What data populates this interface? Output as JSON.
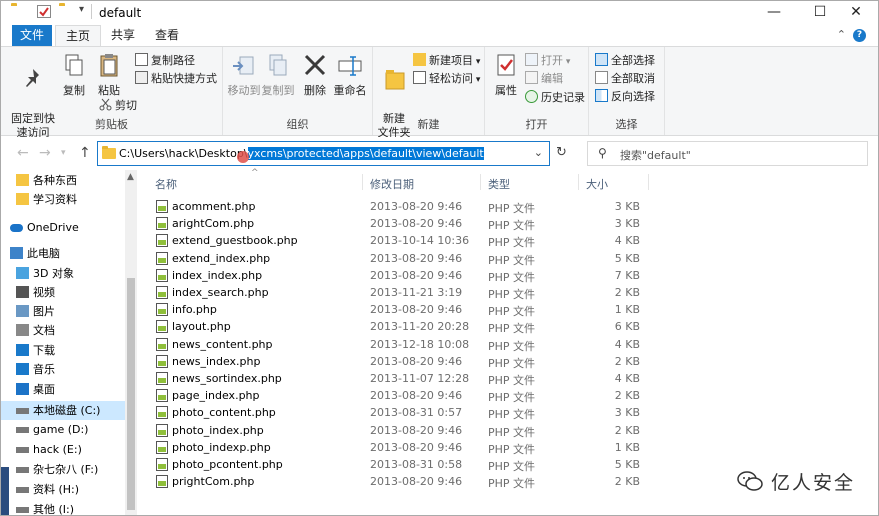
{
  "window": {
    "title": "default",
    "controls": {
      "minimize": "—",
      "maximize": "☐",
      "close": "✕"
    }
  },
  "ribbon_tabs": [
    "文件",
    "主页",
    "共享",
    "查看"
  ],
  "ribbon": {
    "clipboard": {
      "label": "剪贴板",
      "pin": "固定到快\n速访问",
      "copy": "复制",
      "paste": "粘贴",
      "copy_path": "复制路径",
      "paste_shortcut": "粘贴快捷方式",
      "cut": "剪切"
    },
    "organize": {
      "label": "组织",
      "move_to": "移动到",
      "copy_to": "复制到",
      "delete": "删除",
      "rename": "重命名"
    },
    "new": {
      "label": "新建",
      "new_folder": "新建\n文件夹",
      "new_item": "新建项目",
      "easy_access": "轻松访问"
    },
    "open": {
      "label": "打开",
      "properties": "属性",
      "open": "打开",
      "edit": "编辑",
      "history": "历史记录"
    },
    "select": {
      "label": "选择",
      "select_all": "全部选择",
      "select_none": "全部取消",
      "invert": "反向选择"
    }
  },
  "address": {
    "prefix": "C:\\Users\\hack\\Desktop\\",
    "selected": "yxcms\\protected\\apps\\default\\view\\default"
  },
  "search": {
    "placeholder": "搜索\"default\""
  },
  "nav_pane": [
    {
      "label": "各种东西",
      "icon": "folder-icon"
    },
    {
      "label": "学习资料",
      "icon": "folder-icon"
    },
    {
      "label": "OneDrive",
      "icon": "cloud-icon"
    },
    {
      "label": "此电脑",
      "icon": "pc-icon"
    },
    {
      "label": "3D 对象",
      "icon": "cube-icon"
    },
    {
      "label": "视频",
      "icon": "video-icon"
    },
    {
      "label": "图片",
      "icon": "picture-icon"
    },
    {
      "label": "文档",
      "icon": "document-icon"
    },
    {
      "label": "下载",
      "icon": "download-icon"
    },
    {
      "label": "音乐",
      "icon": "music-icon"
    },
    {
      "label": "桌面",
      "icon": "desktop-icon"
    },
    {
      "label": "本地磁盘 (C:)",
      "icon": "drive-icon"
    },
    {
      "label": "game (D:)",
      "icon": "drive-icon"
    },
    {
      "label": "hack (E:)",
      "icon": "drive-icon"
    },
    {
      "label": "杂七杂八 (F:)",
      "icon": "drive-icon"
    },
    {
      "label": "资料 (H:)",
      "icon": "drive-icon"
    },
    {
      "label": "其他 (I:)",
      "icon": "drive-icon"
    }
  ],
  "columns": {
    "name": "名称",
    "modified": "修改日期",
    "type": "类型",
    "size": "大小"
  },
  "files": [
    {
      "name": "acomment.php",
      "modified": "2013-08-20 9:46",
      "type": "PHP 文件",
      "size": "3 KB"
    },
    {
      "name": "arightCom.php",
      "modified": "2013-08-20 9:46",
      "type": "PHP 文件",
      "size": "3 KB"
    },
    {
      "name": "extend_guestbook.php",
      "modified": "2013-10-14 10:36",
      "type": "PHP 文件",
      "size": "4 KB"
    },
    {
      "name": "extend_index.php",
      "modified": "2013-08-20 9:46",
      "type": "PHP 文件",
      "size": "5 KB"
    },
    {
      "name": "index_index.php",
      "modified": "2013-08-20 9:46",
      "type": "PHP 文件",
      "size": "7 KB"
    },
    {
      "name": "index_search.php",
      "modified": "2013-11-21 3:19",
      "type": "PHP 文件",
      "size": "2 KB"
    },
    {
      "name": "info.php",
      "modified": "2013-08-20 9:46",
      "type": "PHP 文件",
      "size": "1 KB"
    },
    {
      "name": "layout.php",
      "modified": "2013-11-20 20:28",
      "type": "PHP 文件",
      "size": "6 KB"
    },
    {
      "name": "news_content.php",
      "modified": "2013-12-18 10:08",
      "type": "PHP 文件",
      "size": "4 KB"
    },
    {
      "name": "news_index.php",
      "modified": "2013-08-20 9:46",
      "type": "PHP 文件",
      "size": "2 KB"
    },
    {
      "name": "news_sortindex.php",
      "modified": "2013-11-07 12:28",
      "type": "PHP 文件",
      "size": "4 KB"
    },
    {
      "name": "page_index.php",
      "modified": "2013-08-20 9:46",
      "type": "PHP 文件",
      "size": "2 KB"
    },
    {
      "name": "photo_content.php",
      "modified": "2013-08-31 0:57",
      "type": "PHP 文件",
      "size": "3 KB"
    },
    {
      "name": "photo_index.php",
      "modified": "2013-08-20 9:46",
      "type": "PHP 文件",
      "size": "2 KB"
    },
    {
      "name": "photo_indexp.php",
      "modified": "2013-08-20 9:46",
      "type": "PHP 文件",
      "size": "1 KB"
    },
    {
      "name": "photo_pcontent.php",
      "modified": "2013-08-31 0:58",
      "type": "PHP 文件",
      "size": "5 KB"
    },
    {
      "name": "prightCom.php",
      "modified": "2013-08-20 9:46",
      "type": "PHP 文件",
      "size": "2 KB"
    }
  ],
  "watermark": {
    "text": "亿人安全"
  },
  "colors": {
    "accent": "#1979ca",
    "selection": "#0078d7",
    "nav_selected": "#cce8ff",
    "folder": "#f5c542"
  }
}
